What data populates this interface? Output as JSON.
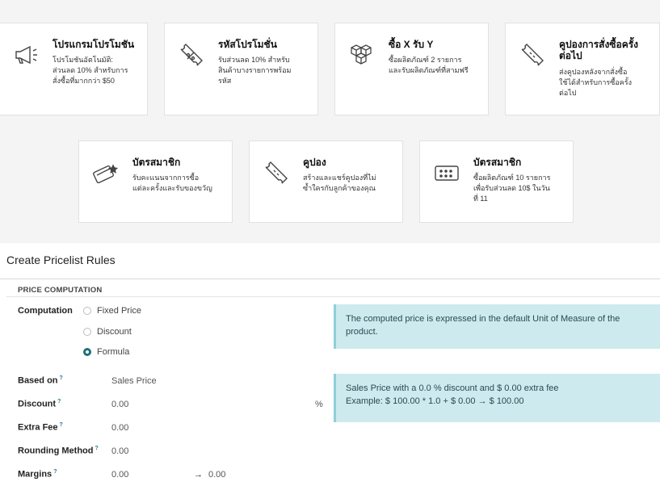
{
  "cards_row1": [
    {
      "title": "โปรแกรมโปรโมชัน",
      "desc1": "โปรโมชันอัตโนมัติ:",
      "desc2": "ส่วนลด 10% สำหรับการ สั่งซื้อที่มากกว่า $50",
      "icon": "megaphone-icon"
    },
    {
      "title": "รหัสโปรโมชั่น",
      "desc1": "รับส่วนลด 10% สำหรับ",
      "desc2": "สินค้าบางรายการพร้อม รหัส",
      "icon": "coupon-percent-icon"
    },
    {
      "title": "ซื้อ X รับ Y",
      "desc1": "ซื้อผลิตภัณฑ์ 2 รายการ",
      "desc2": "และรับผลิตภัณฑ์ที่สามฟรี",
      "icon": "boxes-icon"
    },
    {
      "title": "คูปองการสั่งซื้อครั้งต่อไป",
      "desc1": "ส่งคูปองหลังจากสั่งซื้อ",
      "desc2": "ใช้ได้สำหรับการซื้อครั้ง ต่อไป",
      "icon": "ticket-icon"
    }
  ],
  "cards_row2": [
    {
      "title": "บัตรสมาชิก",
      "desc1": "รับคะแนนจากการซื้อ",
      "desc2": "แต่ละครั้งและรับของขวัญ",
      "icon": "loyalty-card-icon"
    },
    {
      "title": "คูปอง",
      "desc1": "สร้างและแชร์คูปองที่ไม่",
      "desc2": "ซ้ำใครกับลูกค้าของคุณ",
      "icon": "coupon-icon"
    },
    {
      "title": "บัตรสมาชิก",
      "desc1": "ซื้อผลิตภัณฑ์ 10 รายการ",
      "desc2": "เพื่อรับส่วนลด 10$ ในวัน ที่ 11",
      "icon": "stamp-card-icon"
    }
  ],
  "dialog": {
    "title": "Create Pricelist Rules",
    "section": "PRICE COMPUTATION",
    "computation_label": "Computation",
    "options": [
      "Fixed Price",
      "Discount",
      "Formula"
    ],
    "selected": "Formula",
    "based_on_label": "Based on",
    "based_on_value": "Sales Price",
    "discount_label": "Discount",
    "discount_value": "0.00",
    "discount_unit": "%",
    "extra_fee_label": "Extra Fee",
    "extra_fee_value": "0.00",
    "rounding_label": "Rounding Method",
    "rounding_value": "0.00",
    "margins_label": "Margins",
    "margins_min": "0.00",
    "margins_arrow": "→",
    "margins_max": "0.00",
    "help_mark": "?",
    "info1": "The computed price is expressed in the default Unit of Measure of the product.",
    "info2_line1": "Sales Price with a 0.0 % discount and $ 0.00 extra fee",
    "info2_line2": "Example: $ 100.00 * 1.0 + $ 0.00 → $ 100.00"
  }
}
